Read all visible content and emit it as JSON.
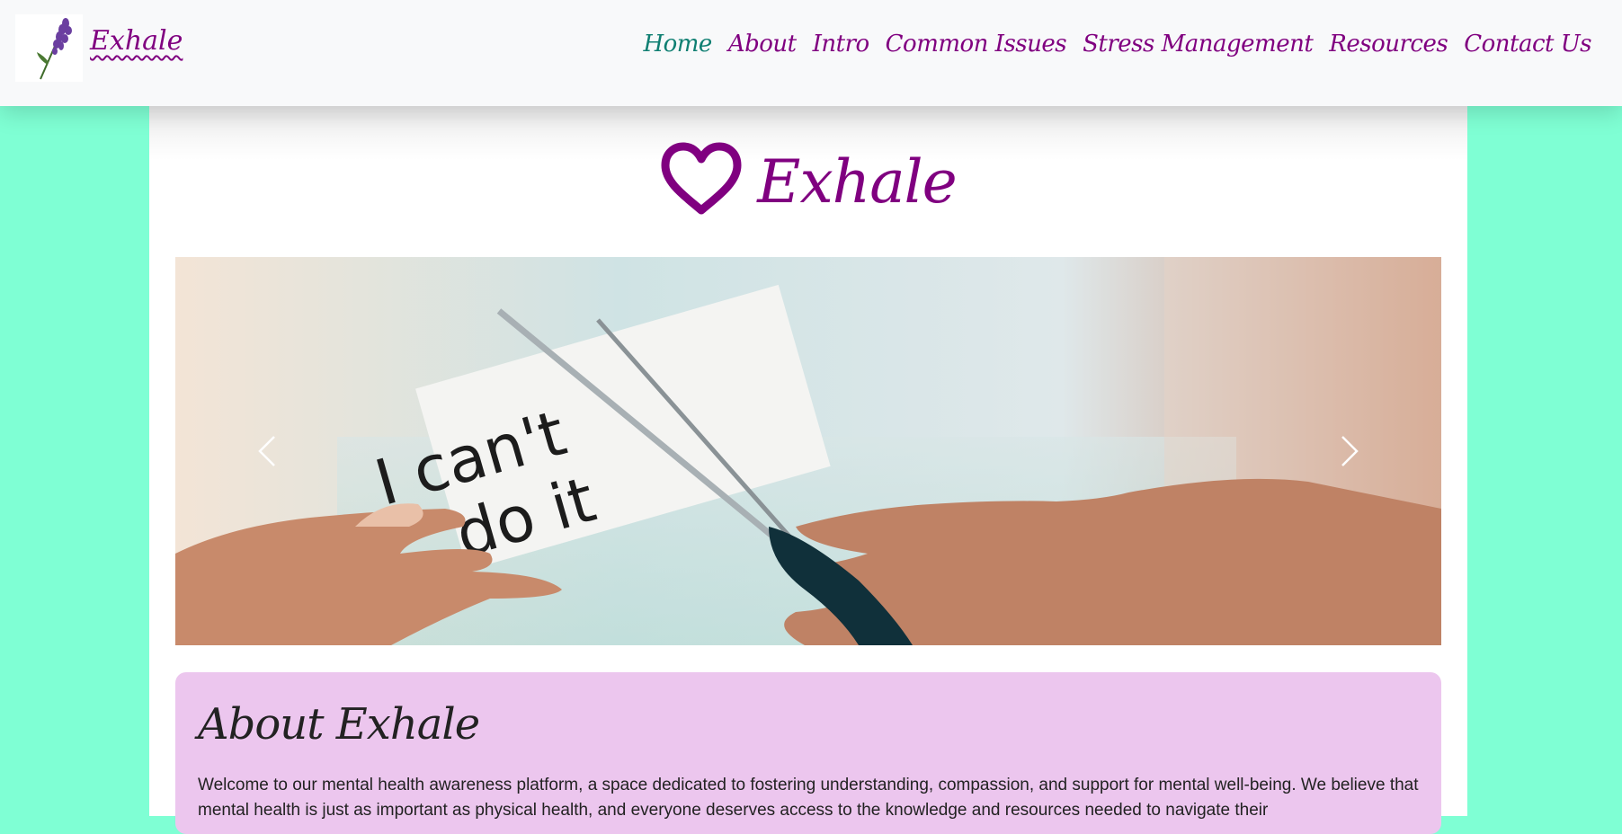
{
  "navbar": {
    "brand": {
      "text": "Exhale",
      "logo_icon": "lavender-sprig-icon"
    },
    "links": [
      {
        "label": "Home",
        "active": true
      },
      {
        "label": "About",
        "active": false
      },
      {
        "label": "Intro",
        "active": false
      },
      {
        "label": "Common Issues",
        "active": false
      },
      {
        "label": "Stress Management",
        "active": false
      },
      {
        "label": "Resources",
        "active": false
      },
      {
        "label": "Contact Us",
        "active": false
      }
    ]
  },
  "hero": {
    "title": "Exhale",
    "icon": "heart-outline-icon"
  },
  "carousel": {
    "slide_note": {
      "line1": "I can't",
      "line2": "do it"
    },
    "prev_icon": "chevron-left-icon",
    "next_icon": "chevron-right-icon"
  },
  "about": {
    "heading": "About Exhale",
    "body": "Welcome to our mental health awareness platform, a space dedicated to fostering understanding, compassion, and support for mental well-being. We believe that mental health is just as important as physical health, and everyone deserves access to the knowledge and resources needed to navigate their"
  },
  "colors": {
    "page_bg": "#7fffd4",
    "brand_purple": "#800080",
    "nav_active": "#0f7f72",
    "navbar_bg": "#f8f9fa",
    "about_bg": "#ecc6ee",
    "text_dark": "#222222"
  }
}
